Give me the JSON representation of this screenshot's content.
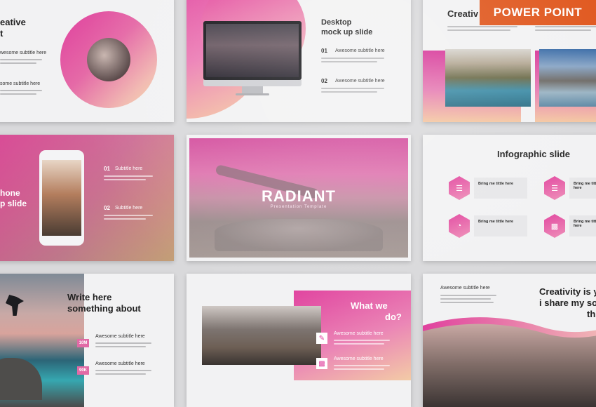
{
  "banner": {
    "label": "POWER POINT"
  },
  "slide1": {
    "title_line1": "eative",
    "title_line2": "t",
    "subtitle_a": "wesome subtitle here",
    "subtitle_b": "some subtitle here"
  },
  "slide2": {
    "title_line1": "Desktop",
    "title_line2": "mock up slide",
    "item1_num": "01",
    "item1_label": "Awesome subtitle here",
    "item2_num": "02",
    "item2_label": "Awesome subtitle here"
  },
  "slide3": {
    "title": "Creativ"
  },
  "slide4": {
    "title_line1": "hone",
    "title_line2": "p slide",
    "item1_num": "01",
    "item1_label": "Subtitle here",
    "item2_num": "02",
    "item2_label": "Subtitle here"
  },
  "slide5": {
    "title": "RADIANT",
    "subtitle": "Presentation Template"
  },
  "slide6": {
    "title": "Infographic slide",
    "items": [
      {
        "label": "Bring me tittle here"
      },
      {
        "label": "Bring me tittle here"
      },
      {
        "label": "Bring me tittle here"
      },
      {
        "label": "Bring me tittle here"
      }
    ]
  },
  "slide7": {
    "title_line1": "Write here",
    "title_line2": "something about",
    "item1_badge": "10M",
    "item1_label": "Awesome subtitle here",
    "item2_badge": "90K",
    "item2_label": "Awesome subtitle here"
  },
  "slide8": {
    "title_line1": "What we",
    "title_line2": "do?",
    "item1_label": "Awesome subtitle here",
    "item2_label": "Awesome subtitle here"
  },
  "slide9": {
    "subtitle": "Awesome subtitle here",
    "title_line1": "Creativity is y",
    "title_line2": "i share my so",
    "title_line3": "th"
  },
  "colors": {
    "accent": "#e0419e",
    "banner": "#e0581f",
    "background": "#d9d9db"
  }
}
